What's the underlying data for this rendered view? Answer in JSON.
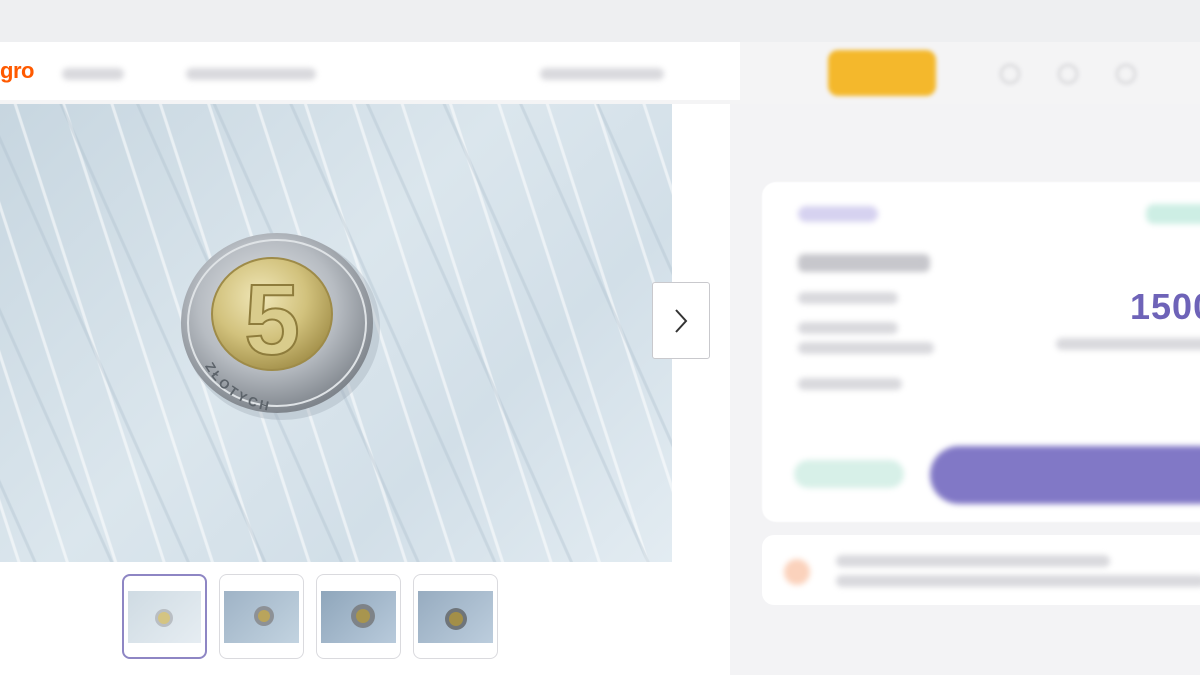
{
  "header": {
    "logo_text": "gro"
  },
  "gallery": {
    "coin": {
      "denomination": "5",
      "inscription": "ZŁOTYCH"
    },
    "thumbnail_count": 4,
    "active_thumbnail": 1,
    "next_icon": "chevron-right-icon"
  },
  "offer": {
    "price": "1500"
  },
  "colors": {
    "brand": "#ff5a00",
    "accent": "#6e63b8",
    "highlight": "#f4b82c"
  }
}
